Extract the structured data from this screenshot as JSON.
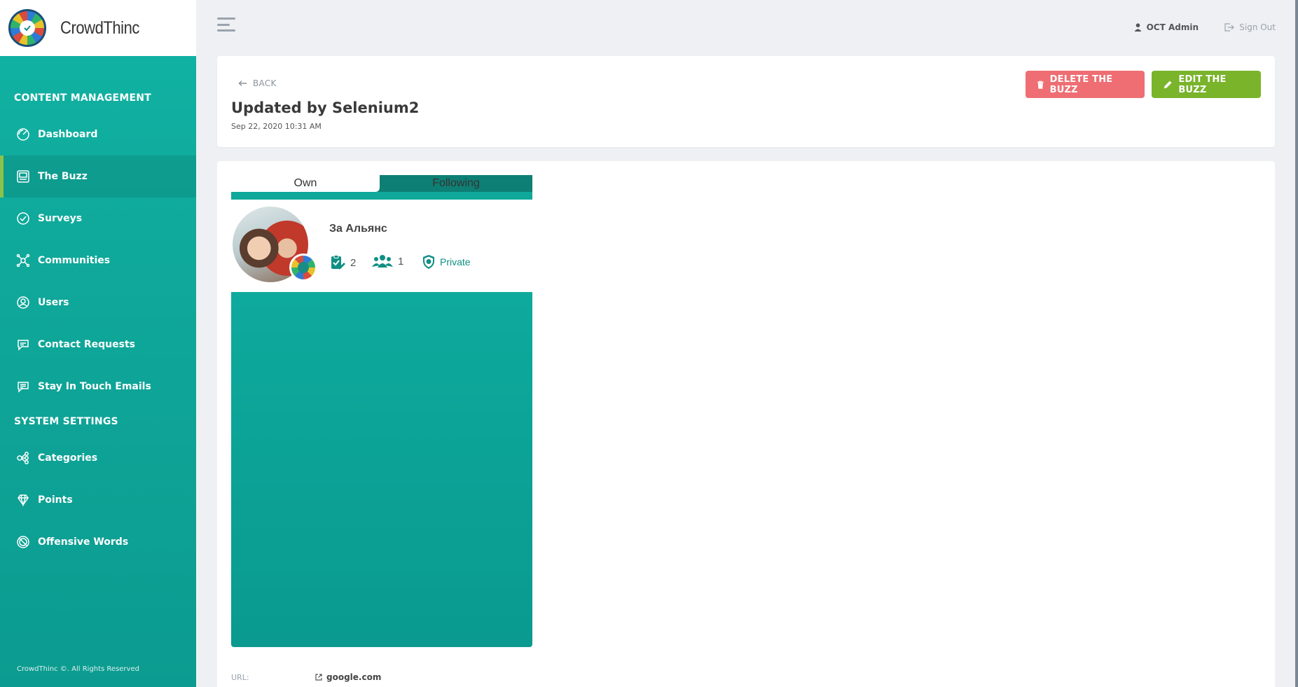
{
  "brand": {
    "name": "CrowdThinc"
  },
  "sidebar": {
    "sections": [
      {
        "title": "CONTENT MANAGEMENT"
      },
      {
        "title": "SYSTEM SETTINGS"
      }
    ],
    "items": [
      {
        "label": "Dashboard",
        "icon": "dashboard-icon"
      },
      {
        "label": "The Buzz",
        "icon": "buzz-icon",
        "active": true
      },
      {
        "label": "Surveys",
        "icon": "surveys-icon"
      },
      {
        "label": "Communities",
        "icon": "communities-icon"
      },
      {
        "label": "Users",
        "icon": "users-icon"
      },
      {
        "label": "Contact Requests",
        "icon": "contact-requests-icon"
      },
      {
        "label": "Stay In Touch Emails",
        "icon": "emails-icon"
      },
      {
        "label": "Categories",
        "icon": "categories-icon"
      },
      {
        "label": "Points",
        "icon": "diamond-icon"
      },
      {
        "label": "Offensive Words",
        "icon": "offensive-words-icon"
      }
    ],
    "footer": "CrowdThinc ©. All Rights Reserved"
  },
  "header": {
    "user_name": "OCT Admin",
    "sign_out": "Sign Out"
  },
  "detail": {
    "back_label": "BACK",
    "title": "Updated by Selenium2",
    "date": "Sep 22, 2020 10:31 AM",
    "delete_label": "DELETE THE BUZZ",
    "edit_label": "EDIT THE BUZZ"
  },
  "preview": {
    "tabs": [
      "Own",
      "Following"
    ],
    "community_name": "За Альянс",
    "surveys_count": "2",
    "members_count": "1",
    "privacy": "Private"
  },
  "url": {
    "label": "URL:",
    "value": "google.com"
  },
  "colors": {
    "sidebar": "#10b3a4",
    "accent_active": "#8bc34a",
    "delete": "#ee6e73",
    "edit": "#79b42b"
  }
}
